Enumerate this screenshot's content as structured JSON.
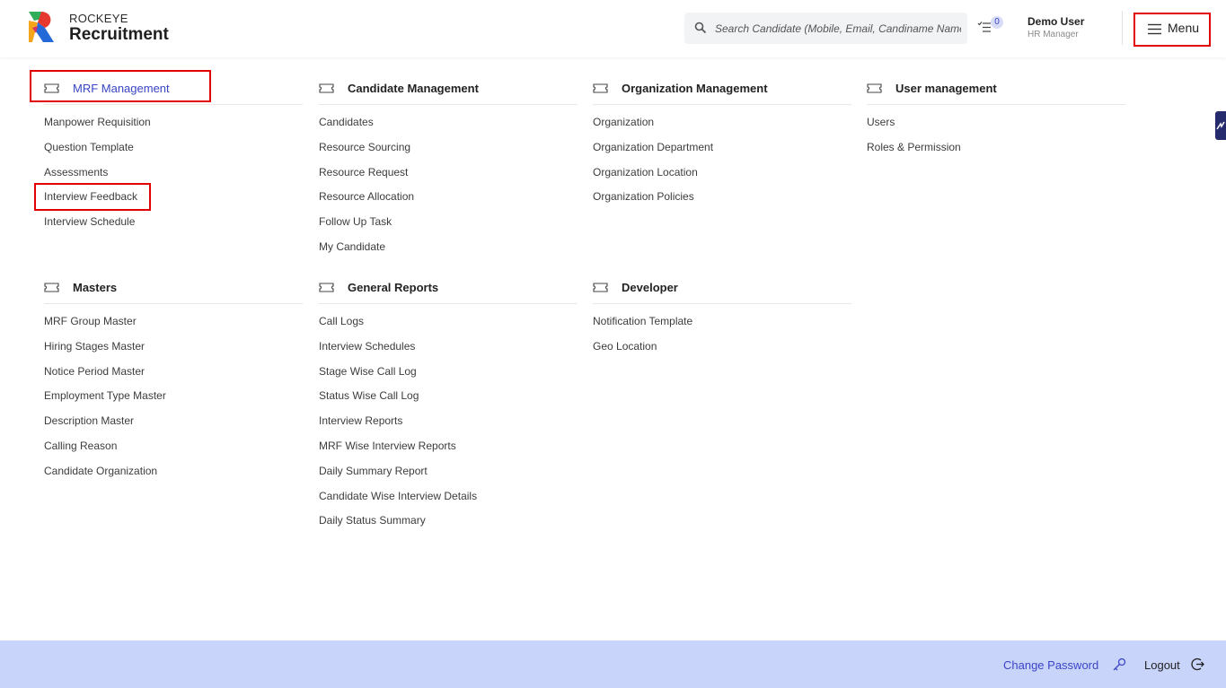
{
  "brand": {
    "top": "ROCKEYE",
    "main": "Recruitment"
  },
  "search": {
    "placeholder": "Search Candidate (Mobile, Email, Candiname Name)"
  },
  "tasks": {
    "count": "0"
  },
  "user": {
    "name": "Demo User",
    "role": "HR Manager"
  },
  "menu": {
    "label": "Menu"
  },
  "sections": [
    {
      "title": "MRF Management",
      "items": [
        "Manpower Requisition",
        "Question Template",
        "Assessments",
        "Interview Feedback",
        "Interview Schedule"
      ]
    },
    {
      "title": "Candidate Management",
      "items": [
        "Candidates",
        "Resource Sourcing",
        "Resource Request",
        "Resource Allocation",
        "Follow Up Task",
        "My Candidate"
      ]
    },
    {
      "title": "Organization Management",
      "items": [
        "Organization",
        "Organization Department",
        "Organization Location",
        "Organization Policies"
      ]
    },
    {
      "title": "User management",
      "items": [
        "Users",
        "Roles & Permission"
      ]
    },
    {
      "title": "Masters",
      "items": [
        "MRF Group Master",
        "Hiring Stages Master",
        "Notice Period Master",
        "Employment Type Master",
        "Description Master",
        "Calling Reason",
        "Candidate Organization"
      ]
    },
    {
      "title": "General Reports",
      "items": [
        "Call Logs",
        "Interview Schedules",
        "Stage Wise Call Log",
        "Status Wise Call Log",
        "Interview Reports",
        "MRF Wise Interview Reports",
        "Daily Summary Report",
        "Candidate Wise Interview Details",
        "Daily Status Summary"
      ]
    },
    {
      "title": "Developer",
      "items": [
        "Notification Template",
        "Geo Location"
      ]
    }
  ],
  "footer": {
    "change_password": "Change Password",
    "logout": "Logout"
  },
  "colors": {
    "accent": "#3845c4",
    "highlight": "#e00000",
    "footer_bg": "#c9d4fb",
    "side_tab": "#262b6e"
  },
  "icons": [
    "search-icon",
    "tasks-icon",
    "hamburger-icon",
    "ticket-icon",
    "key-icon",
    "logout-icon",
    "side-tab-icon"
  ]
}
